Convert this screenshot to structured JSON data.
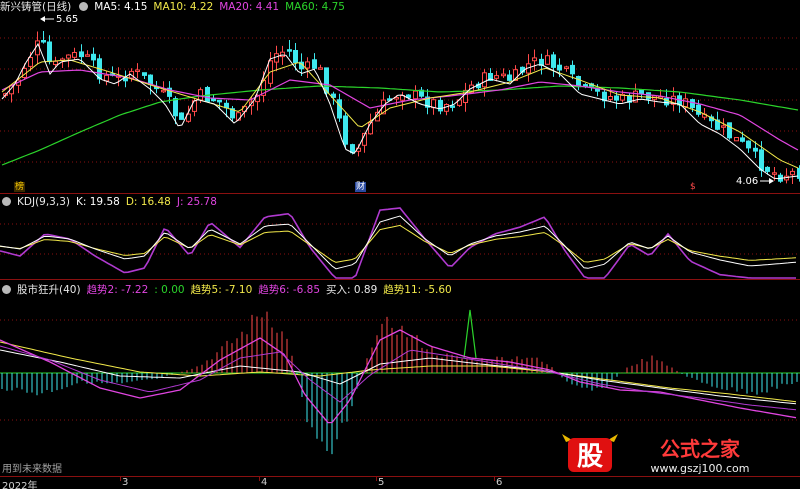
{
  "main_header": {
    "name": "新兴铸管(日线)",
    "ma5": "MA5: 4.15",
    "ma10": "MA10: 4.22",
    "ma20": "MA20: 4.41",
    "ma60": "MA60: 4.75"
  },
  "price_labels": {
    "high": "5.65",
    "low": "4.06"
  },
  "event_markers": {
    "m1": "榜",
    "m2": "财",
    "m3": "$"
  },
  "kdj_header": {
    "name": "KDJ(9,3,3)",
    "k": "K: 19.58",
    "d": "D: 16.48",
    "j": "J: 25.78"
  },
  "ind_header": {
    "name": "股市狂升(40)",
    "t2": "趋势2: -7.22",
    "zero": ": 0.00",
    "t5": "趋势5: -7.10",
    "t6": "趋势6: -6.85",
    "buy": "买入: 0.89",
    "t11": "趋势11: -5.60"
  },
  "footnote": "用到未来数据",
  "x_axis": [
    "2022年",
    "3",
    "4",
    "5",
    "6"
  ],
  "watermark": {
    "glyph": "股",
    "title": "公式之家",
    "url": "www.gszj100.com"
  },
  "colors": {
    "up": "#ff4a4a",
    "down": "#3ee8ee",
    "ma5": "#ffffff",
    "ma10": "#f2e94a",
    "ma20": "#e045e0",
    "ma60": "#2bd42b",
    "grid": "#8a1010"
  }
}
